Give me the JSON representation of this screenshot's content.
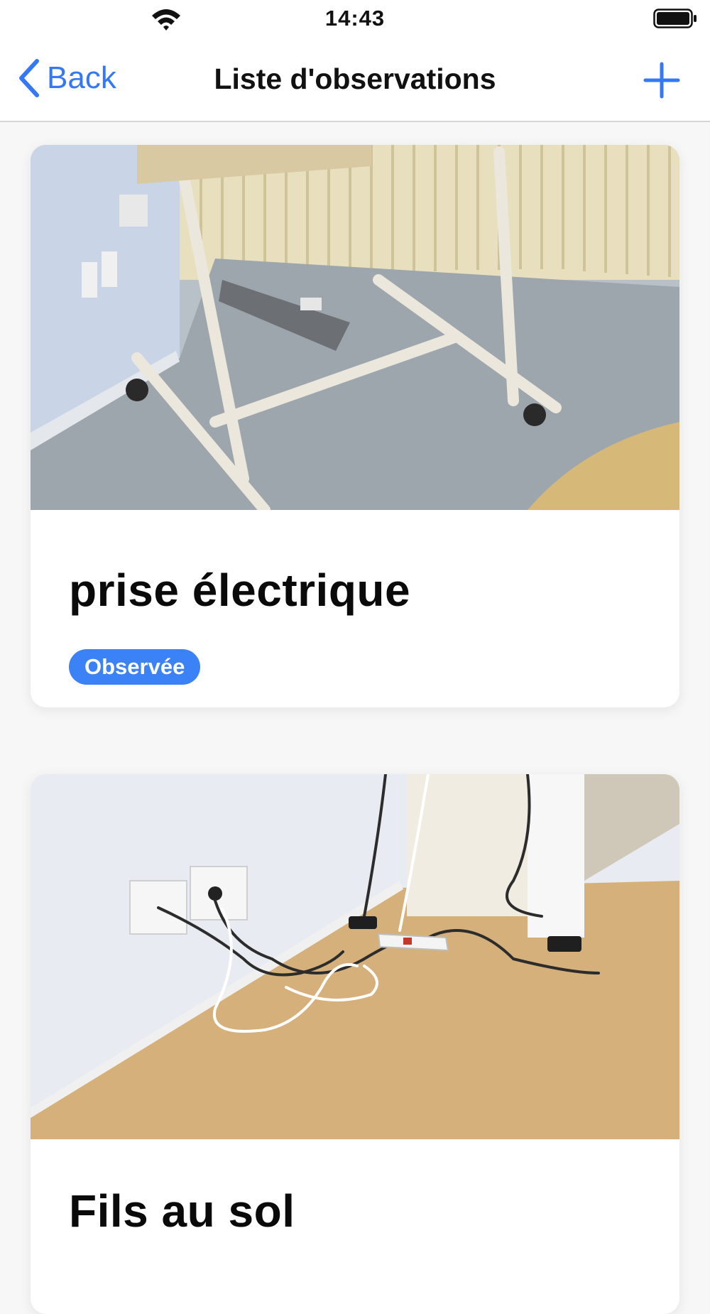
{
  "status_bar": {
    "time": "14:43",
    "icons": [
      "wifi-icon",
      "battery-icon"
    ]
  },
  "nav": {
    "back_label": "Back",
    "title": "Liste d'observations",
    "add_icon": "plus-icon",
    "accent_color": "#3478f6"
  },
  "observations": [
    {
      "title": "prise électrique",
      "status": "Observée",
      "status_color": "#3b82f6",
      "photo": "power strip under a wheeled stand near a radiator"
    },
    {
      "title": "Fils au sol",
      "photo": "cables and a power strip on the floor near a wall socket"
    }
  ]
}
